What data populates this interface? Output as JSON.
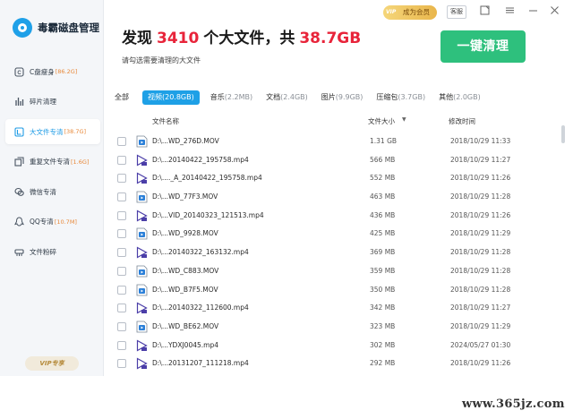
{
  "app": {
    "name": "毒霸磁盘管理"
  },
  "header": {
    "title_prefix": "发现",
    "file_count": "3410",
    "title_middle": "个大文件，共",
    "total_size": "38.7GB",
    "subtitle": "请勾选需要清理的大文件",
    "clean_button": "一键清理"
  },
  "window": {
    "vip_label": "成为会员",
    "service_label": "客服"
  },
  "sidebar": {
    "items": [
      {
        "label": "C盘瘦身",
        "size": "[86.2G]",
        "icon": "c-drive-icon",
        "active": false
      },
      {
        "label": "碎片清理",
        "size": "",
        "icon": "fragment-icon",
        "active": false
      },
      {
        "label": "大文件专清",
        "size": "[38.7G]",
        "icon": "large-file-icon",
        "active": true
      },
      {
        "label": "重复文件专清",
        "size": "[1.6G]",
        "icon": "duplicate-file-icon",
        "active": false
      },
      {
        "label": "微信专清",
        "size": "",
        "icon": "wechat-icon",
        "active": false
      },
      {
        "label": "QQ专清",
        "size": "[10.7M]",
        "icon": "qq-icon",
        "active": false
      },
      {
        "label": "文件粉碎",
        "size": "",
        "icon": "shredder-icon",
        "active": false
      }
    ],
    "vip_service": "VIP专享"
  },
  "tabs": [
    {
      "label": "全部",
      "size": ""
    },
    {
      "label": "视频",
      "size": "(20.8GB)",
      "active": true
    },
    {
      "label": "音乐",
      "size": "(2.2MB)"
    },
    {
      "label": "文档",
      "size": "(2.4GB)"
    },
    {
      "label": "图片",
      "size": "(9.9GB)"
    },
    {
      "label": "压缩包",
      "size": "(3.7GB)"
    },
    {
      "label": "其他",
      "size": "(2.0GB)"
    }
  ],
  "table": {
    "headers": {
      "name": "文件名称",
      "size": "文件大小",
      "date": "修改时间"
    },
    "rows": [
      {
        "name": "D:\\...WD_276D.MOV",
        "size": "1.31 GB",
        "date": "2018/10/29 11:33",
        "type": "mov"
      },
      {
        "name": "D:\\...20140422_195758.mp4",
        "size": "566 MB",
        "date": "2018/10/29 11:27",
        "type": "mp4"
      },
      {
        "name": "D:\\...._A_20140422_195758.mp4",
        "size": "552 MB",
        "date": "2018/10/29 11:26",
        "type": "mp4"
      },
      {
        "name": "D:\\...WD_77F3.MOV",
        "size": "463 MB",
        "date": "2018/10/29 11:28",
        "type": "mov"
      },
      {
        "name": "D:\\...VID_20140323_121513.mp4",
        "size": "436 MB",
        "date": "2018/10/29 11:26",
        "type": "mp4"
      },
      {
        "name": "D:\\...WD_9928.MOV",
        "size": "425 MB",
        "date": "2018/10/29 11:29",
        "type": "mov"
      },
      {
        "name": "D:\\...20140322_163132.mp4",
        "size": "369 MB",
        "date": "2018/10/29 11:28",
        "type": "mp4"
      },
      {
        "name": "D:\\...WD_C883.MOV",
        "size": "359 MB",
        "date": "2018/10/29 11:28",
        "type": "mov"
      },
      {
        "name": "D:\\...WD_B7F5.MOV",
        "size": "350 MB",
        "date": "2018/10/29 11:28",
        "type": "mov"
      },
      {
        "name": "D:\\...20140322_112600.mp4",
        "size": "342 MB",
        "date": "2018/10/29 11:27",
        "type": "mp4"
      },
      {
        "name": "D:\\...WD_BE62.MOV",
        "size": "323 MB",
        "date": "2018/10/29 11:29",
        "type": "mov"
      },
      {
        "name": "D:\\...YDXJ0045.mp4",
        "size": "302 MB",
        "date": "2024/05/27 01:30",
        "type": "mp4"
      },
      {
        "name": "D:\\...20131207_111218.mp4",
        "size": "292 MB",
        "date": "2018/10/29 11:26",
        "type": "mp4"
      }
    ]
  },
  "watermark": "www.365jz.com",
  "colors": {
    "accent": "#1ea0e6",
    "clean_green": "#2ec07d",
    "highlight_red": "#e8243a",
    "size_orange": "#e8893a"
  }
}
